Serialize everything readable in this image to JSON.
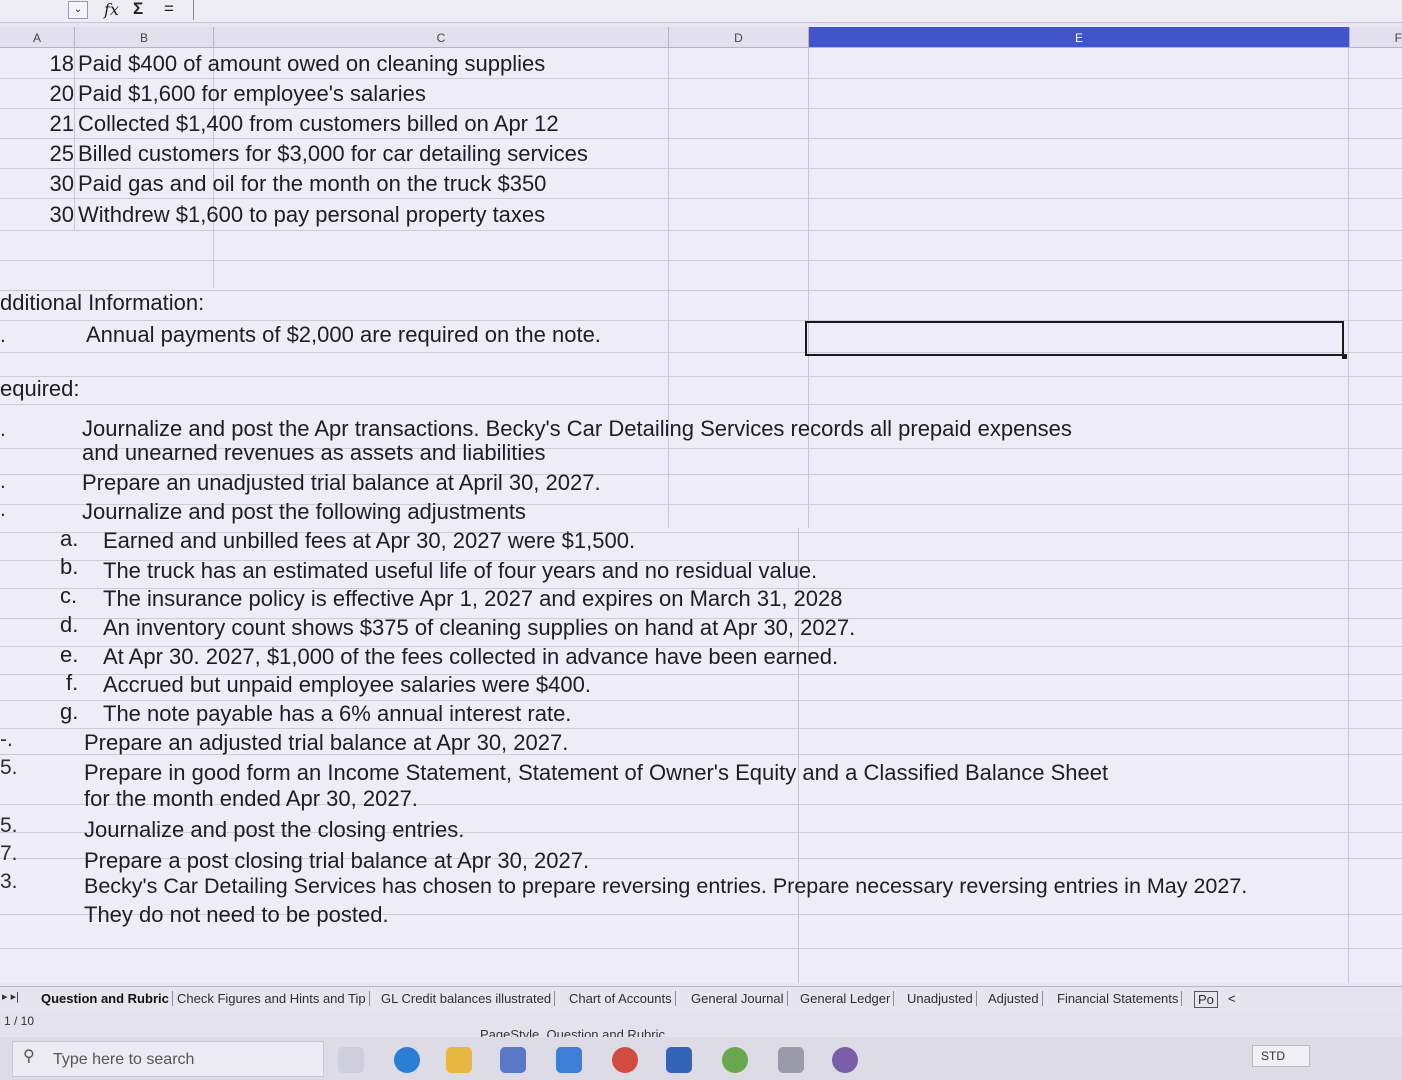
{
  "formula_bar": {
    "name_box_arrow": "⌄",
    "fx": "fx",
    "sum": "Σ",
    "equals": "="
  },
  "columns": [
    "A",
    "B",
    "C",
    "D",
    "E",
    "F"
  ],
  "transactions": [
    {
      "day": "18",
      "text": "Paid $400 of amount owed on cleaning supplies"
    },
    {
      "day": "20",
      "text": "Paid $1,600 for employee's salaries"
    },
    {
      "day": "21",
      "text": "Collected $1,400 from customers billed on Apr 12"
    },
    {
      "day": "25",
      "text": "Billed customers for $3,000 for car detailing services"
    },
    {
      "day": "30",
      "text": "Paid gas and oil for the month on the truck $350"
    },
    {
      "day": "30",
      "text": "Withdrew $1,600 to pay personal property taxes"
    }
  ],
  "additional": {
    "heading": "dditional Information:",
    "mark": ".",
    "text": "Annual payments of $2,000 are required on the note."
  },
  "required": {
    "heading": "equired:",
    "items": [
      {
        "num": ".",
        "lines": [
          "Journalize and post the Apr transactions. Becky's Car Detailing Services records all prepaid expenses",
          "and unearned revenues as assets and liabilities"
        ]
      },
      {
        "num": ".",
        "lines": [
          "Prepare an unadjusted trial balance at April 30, 2027."
        ]
      },
      {
        "num": ".",
        "lines": [
          "Journalize and post the following adjustments"
        ]
      }
    ],
    "adjustments": [
      {
        "letter": "a.",
        "text": "Earned and unbilled fees at Apr 30, 2027 were $1,500."
      },
      {
        "letter": "b.",
        "text": "The truck has an estimated useful life of four years and no residual value."
      },
      {
        "letter": "c.",
        "text": "The insurance policy is effective Apr 1, 2027 and expires on March 31, 2028"
      },
      {
        "letter": "d.",
        "text": "An inventory count shows $375 of cleaning supplies on hand at Apr 30, 2027."
      },
      {
        "letter": "e.",
        "text": "At Apr 30. 2027, $1,000 of the fees collected in advance have been earned."
      },
      {
        "letter": "f.",
        "text": "Accrued but unpaid employee salaries were $400."
      },
      {
        "letter": "g.",
        "text": "The note payable has a 6% annual interest rate."
      }
    ],
    "items2": [
      {
        "num": "-.",
        "lines": [
          "Prepare an adjusted trial balance at Apr 30, 2027."
        ]
      },
      {
        "num": "5.",
        "lines": [
          "Prepare in good form an Income Statement, Statement of Owner's Equity and a Classified Balance Sheet",
          "for the month ended Apr 30,  2027."
        ]
      },
      {
        "num": "5.",
        "lines": [
          "Journalize and post the closing entries."
        ]
      },
      {
        "num": "7.",
        "lines": [
          "Prepare a post closing trial balance at Apr 30, 2027."
        ]
      },
      {
        "num": "3.",
        "lines": [
          "Becky's Car Detailing Services has chosen to prepare reversing entries. Prepare necessary reversing entries in May 2027.",
          "They do not need to be posted."
        ]
      }
    ]
  },
  "sheet_tabs": [
    "Question and Rubric",
    "Check Figures and Hints and Tip",
    "GL Credit balances illustrated",
    "Chart of Accounts",
    "General Journal",
    "General Ledger",
    "Unadjusted",
    "Adjusted",
    "Financial Statements",
    "Po"
  ],
  "tab_nav": "▸  ▸|",
  "tab_scroll_left": "<",
  "status": {
    "page": "1 / 10",
    "page_style": "PageStyle_Question and Rubric"
  },
  "taskbar": {
    "search_placeholder": "Type here to search",
    "search_icon": "⚲",
    "std": "STD"
  }
}
